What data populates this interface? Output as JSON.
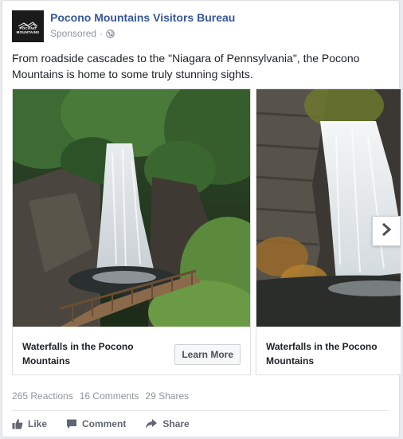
{
  "post": {
    "page_name": "Pocono Mountains Visitors Bureau",
    "sponsored": "Sponsored",
    "separator": "·",
    "logo_text_line1": "POCONO",
    "logo_text_line2": "MOUNTAINS",
    "text": "From roadside cascades to the \"Niagara of Pennsylvania\", the Pocono Mountains is home to some truly stunning sights."
  },
  "carousel": {
    "cards": [
      {
        "caption": "Waterfalls in the Pocono Mountains",
        "cta": "Learn More",
        "image": "waterfall-stairs-photo"
      },
      {
        "caption": "Waterfalls in the Pocono Mountains",
        "image": "waterfall-rocks-photo"
      }
    ],
    "next_icon": "chevron-right-icon"
  },
  "stats": {
    "reactions": "265 Reactions",
    "comments": "16 Comments",
    "shares": "29 Shares"
  },
  "actions": {
    "like": "Like",
    "comment": "Comment",
    "share": "Share"
  },
  "colors": {
    "link": "#365899",
    "meta": "#90949c",
    "border": "#dddfe2"
  }
}
